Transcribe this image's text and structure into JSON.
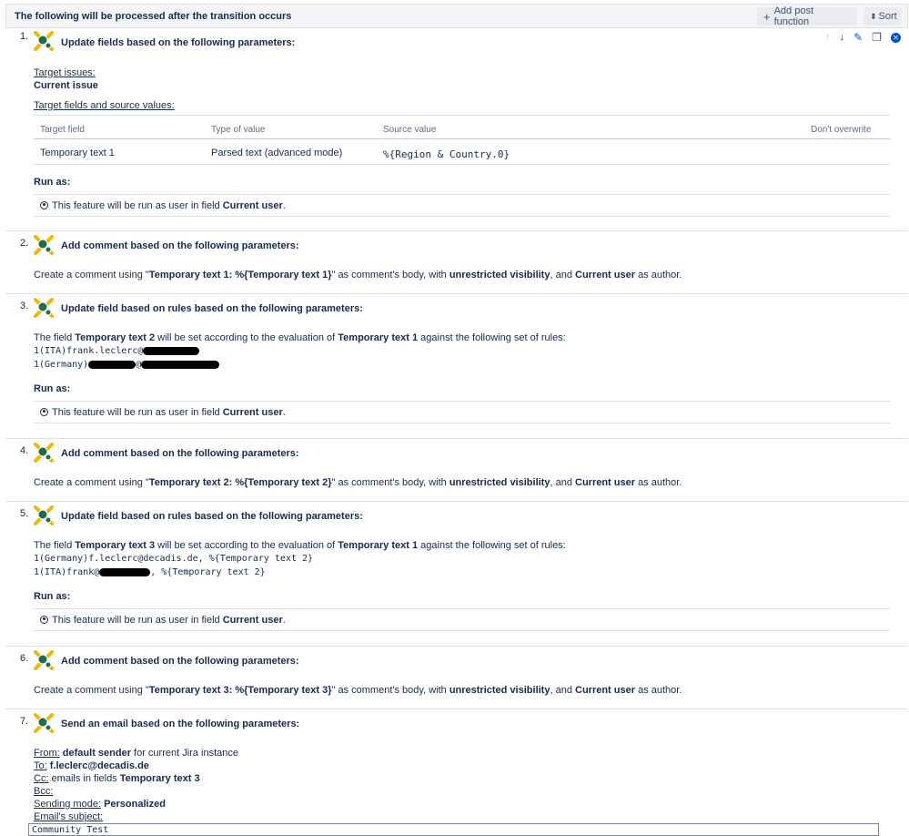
{
  "header": {
    "title": "The following will be processed after the transition occurs",
    "add_label": "Add post function",
    "sort_label": "Sort"
  },
  "run_as_label": "Run as:",
  "run_as_text_prefix": "This feature will be run as user in field",
  "run_as_user": "Current user",
  "pf1": {
    "num": "1.",
    "title": "Update fields based on the following parameters:",
    "target_issues_label": "Target issues:",
    "target_issues_value": "Current issue",
    "target_fields_label": "Target fields and source values:",
    "columns": [
      "Target field",
      "Type of value",
      "Source value",
      "Don't overwrite"
    ],
    "row": [
      "Temporary text 1",
      "Parsed text (advanced mode)",
      "%{Region & Country.0}",
      ""
    ]
  },
  "pf2": {
    "num": "2.",
    "title": "Add comment based on the following parameters:",
    "t1": "Create a comment using \"",
    "b1": "Temporary text 1: %{Temporary text 1}",
    "t2": "\" as comment's body, with ",
    "b2": "unrestricted visibility",
    "t3": ", and ",
    "b3": "Current user",
    "t4": " as author."
  },
  "pf3": {
    "num": "3.",
    "title": "Update field based on rules based on the following parameters:",
    "t1": "The field ",
    "b1": "Temporary text 2",
    "t2": " will be set according to the evaluation of ",
    "b2": "Temporary text 1",
    "t3": " against the following set of rules:",
    "rule1": "1(ITA)frank.leclerc@",
    "rule2a": "1(Germany)",
    "rule2b": "@"
  },
  "pf4": {
    "num": "4.",
    "title": "Add comment based on the following parameters:",
    "t1": "Create a comment using \"",
    "b1": "Temporary text 2: %{Temporary text 2}",
    "t2": "\" as comment's body, with ",
    "b2": "unrestricted visibility",
    "t3": ", and ",
    "b3": "Current user",
    "t4": " as author."
  },
  "pf5": {
    "num": "5.",
    "title": "Update field based on rules based on the following parameters:",
    "t1": "The field ",
    "b1": "Temporary text 3",
    "t2": " will be set according to the evaluation of ",
    "b2": "Temporary text 1",
    "t3": " against the following set of rules:",
    "rule1": "1(Germany)f.leclerc@decadis.de, %{Temporary text 2}",
    "rule2a": "1(ITA)frank@",
    "rule2b": ", %{Temporary text 2}"
  },
  "pf6": {
    "num": "6.",
    "title": "Add comment based on the following parameters:",
    "t1": "Create a comment using \"",
    "b1": "Temporary text 3: %{Temporary text 3}",
    "t2": "\" as comment's body, with ",
    "b2": "unrestricted visibility",
    "t3": ", and ",
    "b3": "Current user",
    "t4": " as author."
  },
  "pf7": {
    "num": "7.",
    "title": "Send an email based on the following parameters:",
    "from_label": "From:",
    "from_bold": "default sender",
    "from_rest": " for current Jira instance",
    "to_label": "To:",
    "to_value": "f.leclerc@decadis.de",
    "cc_label": "Cc:",
    "cc_rest": " emails in fields ",
    "cc_bold": "Temporary text 3",
    "bcc_label": "Bcc:",
    "mode_label": "Sending mode:",
    "mode_value": "Personalized",
    "subject_label": "Email's subject:",
    "subject_value": "Community Test"
  },
  "colors": {
    "header_bg": "#f4f5f7",
    "border": "#dfe1e6",
    "edit_blue": "#0052cc",
    "text": "#172b4d"
  }
}
